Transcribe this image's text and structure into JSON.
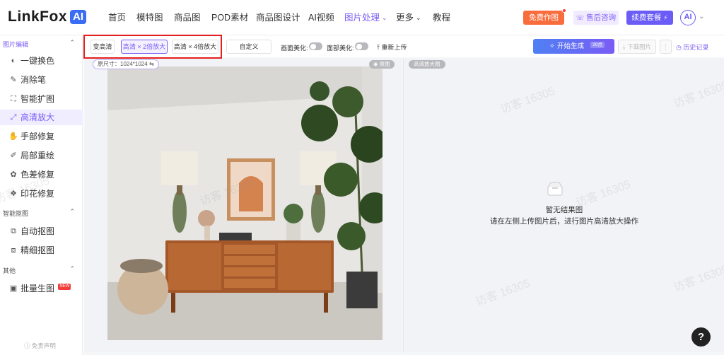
{
  "brand": {
    "name": "LinkFox",
    "badge": "AI"
  },
  "nav": {
    "items": [
      "首页",
      "模特图",
      "商品图",
      "POD素材",
      "商品图设计",
      "AI视频",
      "图片处理",
      "更多",
      "教程"
    ],
    "active": "图片处理"
  },
  "header": {
    "free_label": "免费作图",
    "service_label": "售后咨询",
    "renew_label": "续费套餐",
    "avatar_text": "AI"
  },
  "sidebar": {
    "groups": [
      {
        "label": "图片编辑",
        "items": [
          "一键换色",
          "消除笔",
          "智能扩图",
          "高清放大",
          "手部修复",
          "局部重绘",
          "色差修复",
          "印花修复"
        ]
      },
      {
        "label": "智能抠图",
        "items": [
          "自动抠图",
          "精细抠图"
        ]
      },
      {
        "label": "其他",
        "items": [
          "批量生图"
        ]
      }
    ],
    "active_item": "高清放大",
    "new_badge": "NEW",
    "footer": "免责声明"
  },
  "toolbar": {
    "modes": [
      "变高清",
      "高清 × 2倍放大",
      "高清 × 4倍放大",
      "自定义"
    ],
    "selected_mode": "高清 × 2倍放大",
    "face_beautify_label": "画面美化:",
    "face_beautify_on": false,
    "local_beautify_label": "面部美化:",
    "local_beautify_on": false,
    "reupload_label": "重新上传",
    "generate_label": "开始生成",
    "generate_cost": "20点",
    "download_label": "下载图片",
    "more_label": "⋮",
    "history_label": "历史记录"
  },
  "left_panel": {
    "size_label": "原尺寸：1024*1024",
    "original_tag": "原图"
  },
  "right_panel": {
    "result_tag": "高清放大图",
    "empty_title": "暂无结果图",
    "empty_desc": "请在左侧上传图片后，进行图片高清放大操作"
  },
  "watermark": "访客 16305",
  "help_label": "?",
  "colors": {
    "accent": "#7b5cf5",
    "free_btn": "#f96d3d",
    "highlight_box": "#e21e1e",
    "generate_btn": "#5a72f3"
  }
}
